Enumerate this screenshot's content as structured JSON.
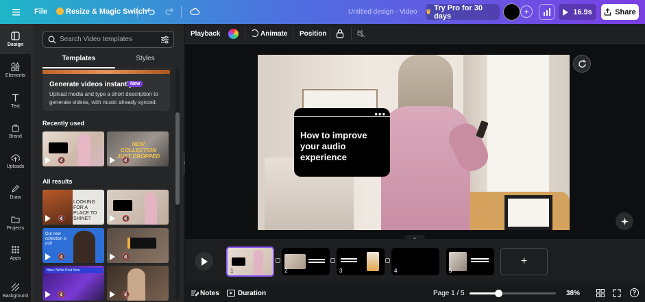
{
  "topbar": {
    "file_label": "File",
    "resize_label": "Resize & Magic Switch",
    "doc_title": "Untitled design - Video",
    "try_pro_label": "Try Pro for 30 days",
    "play_duration": "16.9s",
    "share_label": "Share"
  },
  "rail": {
    "items": [
      {
        "label": "Design",
        "icon": "design-icon"
      },
      {
        "label": "Elements",
        "icon": "elements-icon"
      },
      {
        "label": "Text",
        "icon": "text-icon"
      },
      {
        "label": "Brand",
        "icon": "brand-icon"
      },
      {
        "label": "Uploads",
        "icon": "uploads-icon"
      },
      {
        "label": "Draw",
        "icon": "draw-icon"
      },
      {
        "label": "Projects",
        "icon": "projects-icon"
      },
      {
        "label": "Apps",
        "icon": "apps-icon"
      },
      {
        "label": "Background",
        "icon": "background-icon"
      }
    ]
  },
  "panel": {
    "search_placeholder": "Search Video templates",
    "tabs": [
      "Templates",
      "Styles"
    ],
    "promo": {
      "title": "Generate videos instantly",
      "badge": "New",
      "description": "Upload media and type a short description to generate videos, with music already synced."
    },
    "recently_used_label": "Recently used",
    "all_results_label": "All results",
    "recent_thumbs": [
      {
        "caption": ""
      },
      {
        "caption": "NEW COLLECTION JUST DROPPED"
      }
    ],
    "result_thumbs": [
      {
        "caption": "LOOKING FOR A PLACE TO SHINE?"
      },
      {
        "caption": ""
      },
      {
        "caption": "Our new collection is out!"
      },
      {
        "caption": ""
      },
      {
        "caption": "How I Write Post Now"
      },
      {
        "caption": ""
      }
    ]
  },
  "editor_toolbar": {
    "playback_label": "Playback",
    "animate_label": "Animate",
    "position_label": "Position"
  },
  "stage": {
    "overlay_text": "How to improve your audio experience"
  },
  "timeline": {
    "pages": [
      "1",
      "2",
      "3",
      "4",
      "5"
    ],
    "selected_page": 1
  },
  "bottombar": {
    "notes_label": "Notes",
    "duration_label": "Duration",
    "page_indicator": "Page 1 / 5",
    "zoom_level": "38%",
    "zoom_fraction": 0.33
  }
}
